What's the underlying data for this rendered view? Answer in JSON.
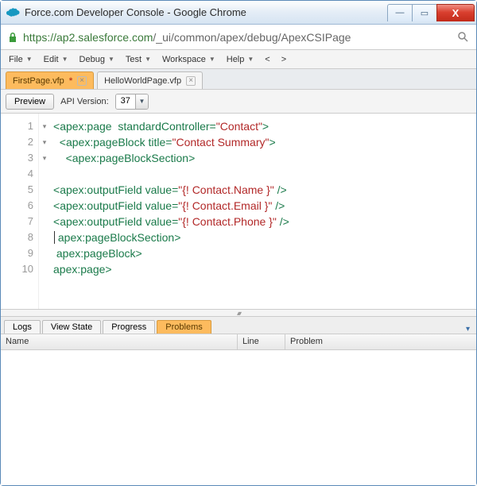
{
  "window": {
    "title": "Force.com Developer Console - Google Chrome"
  },
  "win_controls": {
    "min": "—",
    "max": "▭",
    "close": "X"
  },
  "address": {
    "scheme_host": "https://ap2.salesforce.com",
    "path": "/_ui/common/apex/debug/ApexCSIPage"
  },
  "menus": {
    "file": "File",
    "edit": "Edit",
    "debug": "Debug",
    "test": "Test",
    "workspace": "Workspace",
    "help": "Help",
    "prev": "<",
    "next": ">"
  },
  "tabs": [
    {
      "label": "FirstPage.vfp",
      "dirty": "*",
      "active": true
    },
    {
      "label": "HelloWorldPage.vfp",
      "dirty": "",
      "active": false
    }
  ],
  "toolbar": {
    "preview": "Preview",
    "api_label": "API Version:",
    "api_value": "37"
  },
  "code": {
    "lines": [
      {
        "n": 1,
        "fold": "▾",
        "indent": "",
        "open": "<",
        "tag": "apex:page",
        "after_tag": "  ",
        "attr": "standardController",
        "eq": "=",
        "str": "\"Contact\"",
        "close": ">"
      },
      {
        "n": 2,
        "fold": "▾",
        "indent": "  ",
        "open": "<",
        "tag": "apex:pageBlock",
        "after_tag": " ",
        "attr": "title",
        "eq": "=",
        "str": "\"Contact Summary\"",
        "close": ">"
      },
      {
        "n": 3,
        "fold": "▾",
        "indent": "    ",
        "open": "<",
        "tag": "apex:pageBlockSection",
        "close": ">"
      },
      {
        "n": 4,
        "blank": true
      },
      {
        "n": 5,
        "indent": "",
        "open": "<",
        "tag": "apex:outputField",
        "after_tag": " ",
        "attr": "value",
        "eq": "=",
        "str": "\"{! Contact.Name }\"",
        "close": " />"
      },
      {
        "n": 6,
        "indent": "",
        "open": "<",
        "tag": "apex:outputField",
        "after_tag": " ",
        "attr": "value",
        "eq": "=",
        "str": "\"{! Contact.Email }\"",
        "close": " />"
      },
      {
        "n": 7,
        "indent": "",
        "open": "<",
        "tag": "apex:outputField",
        "after_tag": " ",
        "attr": "value",
        "eq": "=",
        "str": "\"{! Contact.Phone }\"",
        "close": " />"
      },
      {
        "n": 8,
        "indent": "",
        "cursor": true,
        "open": " </",
        "tag": "apex:pageBlockSection",
        "close": ">"
      },
      {
        "n": 9,
        "indent": " ",
        "open": "</",
        "tag": "apex:pageBlock",
        "close": ">"
      },
      {
        "n": 10,
        "indent": "",
        "open": "</",
        "tag": "apex:page",
        "close": ">"
      }
    ]
  },
  "panel": {
    "tabs": {
      "logs": "Logs",
      "viewstate": "View State",
      "progress": "Progress",
      "problems": "Problems"
    },
    "columns": {
      "name": "Name",
      "line": "Line",
      "problem": "Problem"
    }
  }
}
